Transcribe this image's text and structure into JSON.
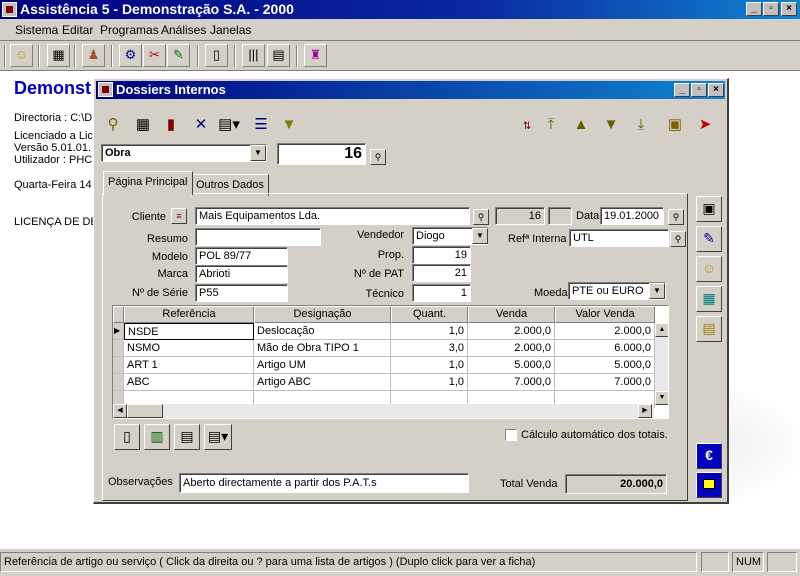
{
  "app": {
    "title": "Assistência 5 - Demonstração S.A. - 2000",
    "menu": [
      "Sistema",
      "Editar",
      "Programas",
      "Análises",
      "Janelas"
    ],
    "window_buttons": {
      "minimize": "_",
      "restore": "▫",
      "close": "×"
    }
  },
  "background": {
    "company_title": "Demonst",
    "lines": [
      "Directoria : C:\\DE",
      "Licenciado a Lic",
      "Versão 5.01.01.",
      "Utilizador : PHC i"
    ],
    "date": "Quarta-Feira 14",
    "license": "LICENÇA DE DEM"
  },
  "dossier": {
    "title": "Dossiers Internos",
    "type_select": "Obra",
    "number": "16",
    "tabs": [
      "Página Principal",
      "Outros Dados"
    ],
    "labels": {
      "cliente": "Cliente",
      "resumo": "Resumo",
      "modelo": "Modelo",
      "marca": "Marca",
      "serie": "Nº de Série",
      "vendedor": "Vendedor",
      "prop": "Prop.",
      "npat": "Nº de PAT",
      "tecnico": "Técnico",
      "data": "Data",
      "ref_interna": "Refª Interna",
      "moeda": "Moeda",
      "calculo": "Cálculo automático dos totais.",
      "observacoes": "Observações",
      "total_venda": "Total Venda"
    },
    "values": {
      "cliente": "Mais Equipamentos Lda.",
      "cliente_num": "16",
      "resumo": "",
      "modelo": "POL 89/77",
      "marca": "Abrioti",
      "serie": "P55",
      "vendedor": "Diogo",
      "prop": "19",
      "npat": "21",
      "tecnico": "1",
      "data": "19.01.2000",
      "ref_interna": "UTL",
      "moeda": "PTE ou EURO",
      "observacoes": "Aberto directamente a partir dos P.A.T.s",
      "total_venda": "20.000,0"
    },
    "grid": {
      "columns": [
        "Referência",
        "Designação",
        "Quant.",
        "Venda",
        "Valor Venda"
      ],
      "rows": [
        [
          "NSDE",
          "Deslocação",
          "1,0",
          "2.000,0",
          "2.000,0"
        ],
        [
          "NSMO",
          "Mão de Obra TIPO 1",
          "3,0",
          "2.000,0",
          "6.000,0"
        ],
        [
          "ART 1",
          "Artigo UM",
          "1,0",
          "5.000,0",
          "5.000,0"
        ],
        [
          "ABC",
          "Artigo ABC",
          "1,0",
          "7.000,0",
          "7.000,0"
        ]
      ],
      "row_marker": "▶"
    },
    "euro_symbol": "€"
  },
  "statusbar": {
    "hint": "Referência de artigo ou serviço ( Click da direita ou ? para uma lista de artigos ) (Duplo click para ver a ficha)",
    "num": "NUM"
  }
}
